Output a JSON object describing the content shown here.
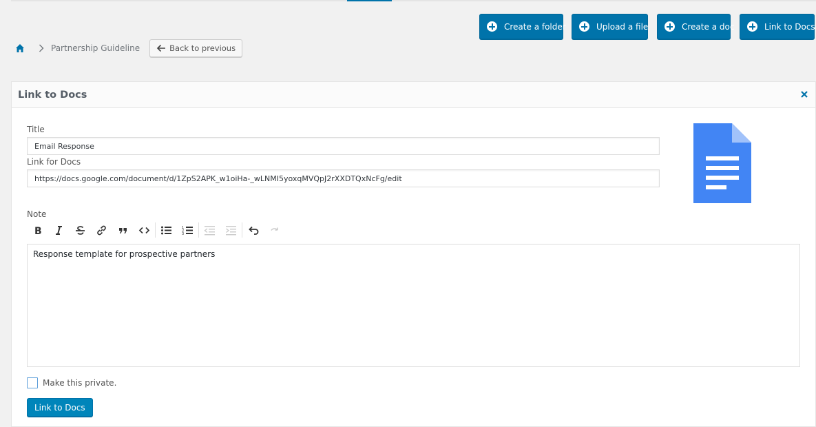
{
  "actions": {
    "create_folder": "Create a folder",
    "upload_file": "Upload a file",
    "create_doc": "Create a doc",
    "link_docs": "Link to Docs"
  },
  "breadcrumb": {
    "home_icon": "home-icon",
    "current": "Partnership Guideline",
    "back_label": "Back to previous"
  },
  "panel": {
    "title": "Link to Docs",
    "title_label": "Title",
    "title_value": "Email Response",
    "link_label": "Link for Docs",
    "link_value": "https://docs.google.com/document/d/1ZpS2APK_w1oiHa-_wLNMI5yoxqMVQpJ2rXXDTQxNcFg/edit",
    "doc_icon": "google-doc-icon",
    "note_label": "Note",
    "toolbar": [
      "bold",
      "italic",
      "strikethrough",
      "link",
      "blockquote",
      "code",
      "bullet-list",
      "numbered-list",
      "outdent",
      "indent",
      "undo",
      "redo"
    ],
    "note_text": "Response template for prospective partners",
    "private_label": "Make this private.",
    "submit_label": "Link to Docs"
  },
  "colors": {
    "primary": "#0073aa",
    "doc_blue": "#4285f4",
    "background": "#f1f1f1"
  }
}
